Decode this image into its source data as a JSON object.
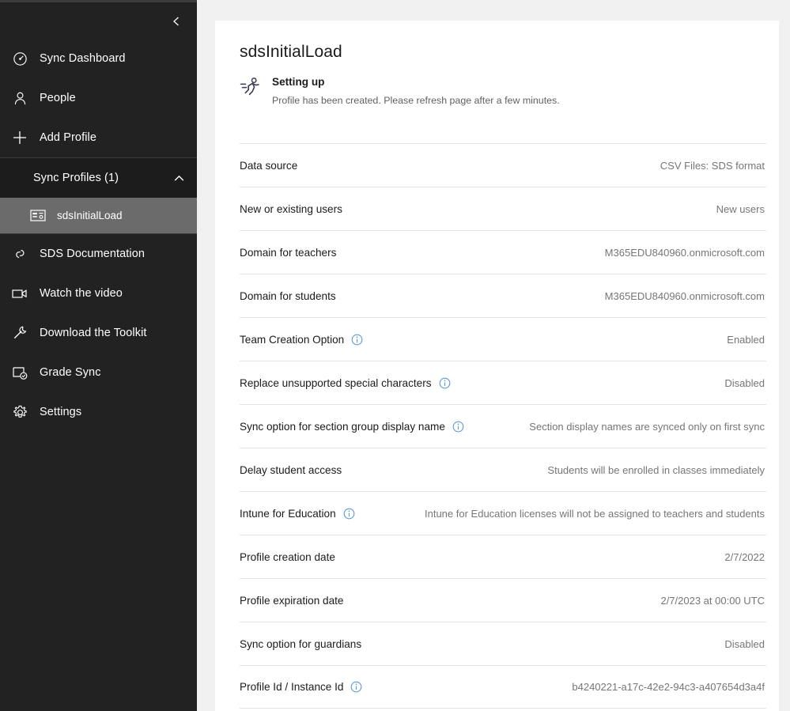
{
  "sidebar": {
    "collapse_button": {
      "name": "collapse-sidebar",
      "icon": "chevron-left-icon"
    },
    "items": [
      {
        "label": "Sync Dashboard",
        "icon": "gauge-icon"
      },
      {
        "label": "People",
        "icon": "person-icon"
      },
      {
        "label": "Add Profile",
        "icon": "plus-icon"
      }
    ],
    "group": {
      "label": "Sync Profiles (1)",
      "chevron": "chevron-up-icon",
      "expanded": true,
      "children": [
        {
          "label": "sdsInitialLoad",
          "icon": "profile-card-icon",
          "selected": true
        }
      ]
    },
    "links": [
      {
        "label": "SDS Documentation",
        "icon": "link-icon"
      },
      {
        "label": "Watch the video",
        "icon": "video-icon"
      },
      {
        "label": "Download the Toolkit",
        "icon": "wrench-icon"
      },
      {
        "label": "Grade Sync",
        "icon": "grade-sync-icon"
      },
      {
        "label": "Settings",
        "icon": "gear-icon"
      }
    ],
    "colors": {
      "background": "#222222",
      "group_background": "#1c1c1c",
      "selected_background": "#6b6b6b",
      "text": "#ffffff",
      "divider": "#3a3a3a"
    }
  },
  "main": {
    "title": "sdsInitialLoad",
    "status": {
      "icon": "running-person-icon",
      "title": "Setting up",
      "description": "Profile has been created. Please refresh page after a few minutes."
    },
    "details": [
      {
        "label": "Data source",
        "value": "CSV Files: SDS format",
        "info": false
      },
      {
        "label": "New or existing users",
        "value": "New users",
        "info": false
      },
      {
        "label": "Domain for teachers",
        "value": "M365EDU840960.onmicrosoft.com",
        "info": false
      },
      {
        "label": "Domain for students",
        "value": "M365EDU840960.onmicrosoft.com",
        "info": false
      },
      {
        "label": "Team Creation Option",
        "value": "Enabled",
        "info": true
      },
      {
        "label": "Replace unsupported special characters",
        "value": "Disabled",
        "info": true
      },
      {
        "label": "Sync option for section group display name",
        "value": "Section display names are synced only on first sync",
        "info": true
      },
      {
        "label": "Delay student access",
        "value": "Students will be enrolled in classes immediately",
        "info": false
      },
      {
        "label": "Intune for Education",
        "value": "Intune for Education licenses will not be assigned to teachers and students",
        "info": true
      },
      {
        "label": "Profile creation date",
        "value": "2/7/2022",
        "info": false
      },
      {
        "label": "Profile expiration date",
        "value": "2/7/2023 at 00:00 UTC",
        "info": false
      },
      {
        "label": "Sync option for guardians",
        "value": "Disabled",
        "info": false
      },
      {
        "label": "Profile Id / Instance Id",
        "value": "b4240221-a17c-42e2-94c3-a407654d3a4f",
        "info": true
      }
    ]
  },
  "colors": {
    "page_background": "#f0f0f0",
    "panel_background": "#ffffff",
    "label_text": "#1b1b1b",
    "value_text": "#767676",
    "divider": "#e3e3e3",
    "info_icon": "#5b9bd5"
  }
}
